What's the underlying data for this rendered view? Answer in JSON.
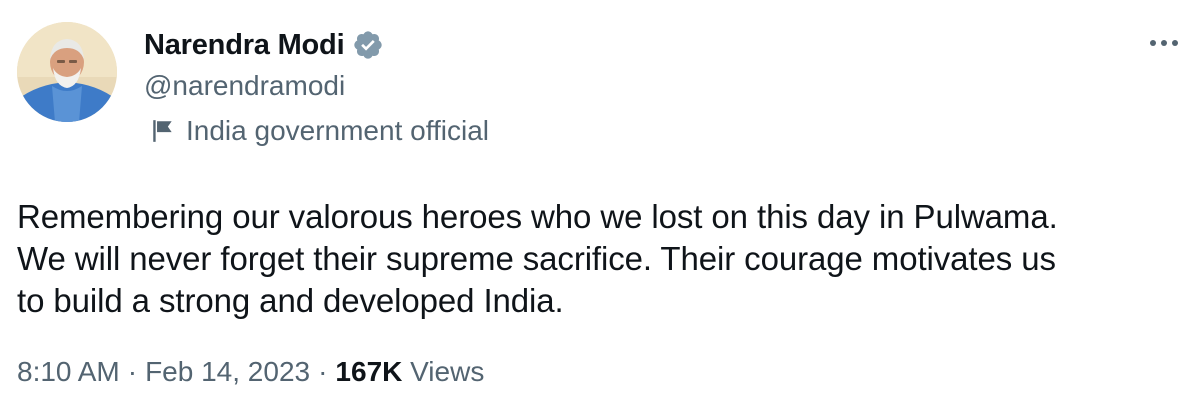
{
  "author": {
    "display_name": "Narendra Modi",
    "handle": "@narendramodi",
    "affiliation": "India government official",
    "verified_color": "#829aab"
  },
  "tweet": {
    "text": "Remembering our valorous heroes who we lost on this day in Pulwama.\nWe will never forget their supreme sacrifice. Their courage motivates us\nto build a strong and developed India."
  },
  "meta": {
    "time": "8:10 AM",
    "separator": "·",
    "date": "Feb 14, 2023",
    "views_count": "167K",
    "views_label": "Views"
  },
  "icons": {
    "verified": "verified-badge-icon",
    "flag": "flag-icon",
    "more": "more-dots-icon"
  }
}
